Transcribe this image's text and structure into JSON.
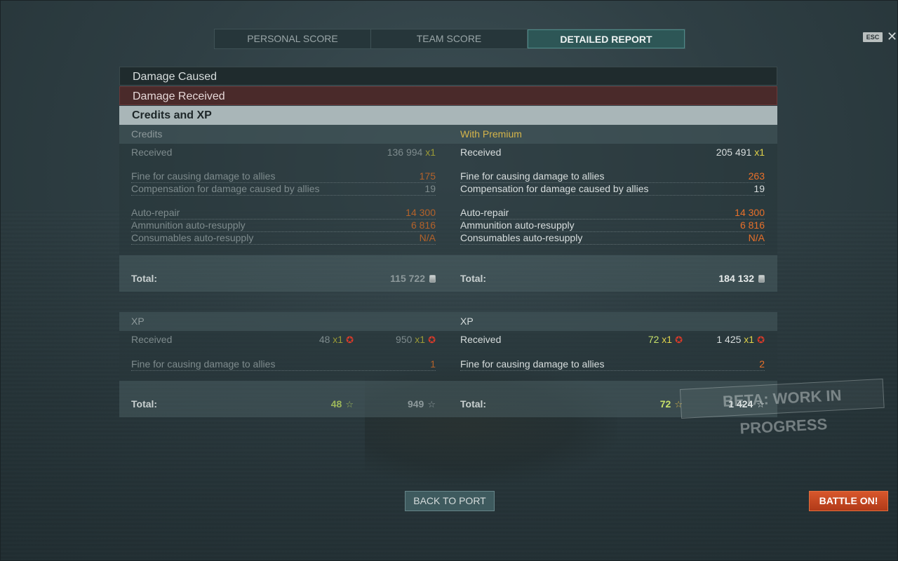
{
  "tabs": [
    "PERSONAL SCORE",
    "TEAM SCORE",
    "DETAILED REPORT"
  ],
  "active_tab": "DETAILED REPORT",
  "esc_label": "ESC",
  "close_glyph": "✕",
  "sections": {
    "damage_caused": "Damage Caused",
    "damage_received": "Damage Received",
    "credits_xp": "Credits and XP"
  },
  "credits": {
    "left": {
      "header": "Credits",
      "received_label": "Received",
      "received_value": "136 994",
      "received_mult": "x1",
      "fine_label": "Fine for causing damage to allies",
      "fine_value": "175",
      "comp_label": "Compensation for damage caused by allies",
      "comp_value": "19",
      "repair_label": "Auto-repair",
      "repair_value": "14 300",
      "ammo_label": "Ammunition auto-resupply",
      "ammo_value": "6 816",
      "cons_label": "Consumables auto-resupply",
      "cons_value": "N/A",
      "total_label": "Total:",
      "total_value": "115 722"
    },
    "right": {
      "header": "With Premium",
      "received_label": "Received",
      "received_value": "205 491",
      "received_mult": "x1",
      "fine_label": "Fine for causing damage to allies",
      "fine_value": "263",
      "comp_label": "Compensation for damage caused by allies",
      "comp_value": "19",
      "repair_label": "Auto-repair",
      "repair_value": "14 300",
      "ammo_label": "Ammunition auto-resupply",
      "ammo_value": "6 816",
      "cons_label": "Consumables auto-resupply",
      "cons_value": "N/A",
      "total_label": "Total:",
      "total_value": "184 132"
    }
  },
  "xp": {
    "left": {
      "header": "XP",
      "received_label": "Received",
      "received_a": "48",
      "received_a_mult": "x1",
      "received_b": "950",
      "received_b_mult": "x1",
      "fine_label": "Fine for causing damage to allies",
      "fine_value": "1",
      "total_label": "Total:",
      "total_a": "48",
      "total_b": "949"
    },
    "right": {
      "header": "XP",
      "received_label": "Received",
      "received_a": "72",
      "received_a_mult": "x1",
      "received_b": "1 425",
      "received_b_mult": "x1",
      "fine_label": "Fine for causing damage to allies",
      "fine_value": "2",
      "total_label": "Total:",
      "total_a": "72",
      "total_b": "1 424"
    }
  },
  "watermark": "BETA: WORK IN PROGRESS",
  "buttons": {
    "back_to_port": "BACK TO PORT",
    "battle_on": "BATTLE ON!"
  },
  "colors": {
    "accent_tab": "#2d5656",
    "penalty": "#e8702a",
    "premium_header": "#d6b54a",
    "battle_button": "#c8461f"
  },
  "icons": {
    "credits": "credits-coin-icon",
    "xp_premium": "red-star-icon",
    "xp_total": "star-outline-icon"
  }
}
